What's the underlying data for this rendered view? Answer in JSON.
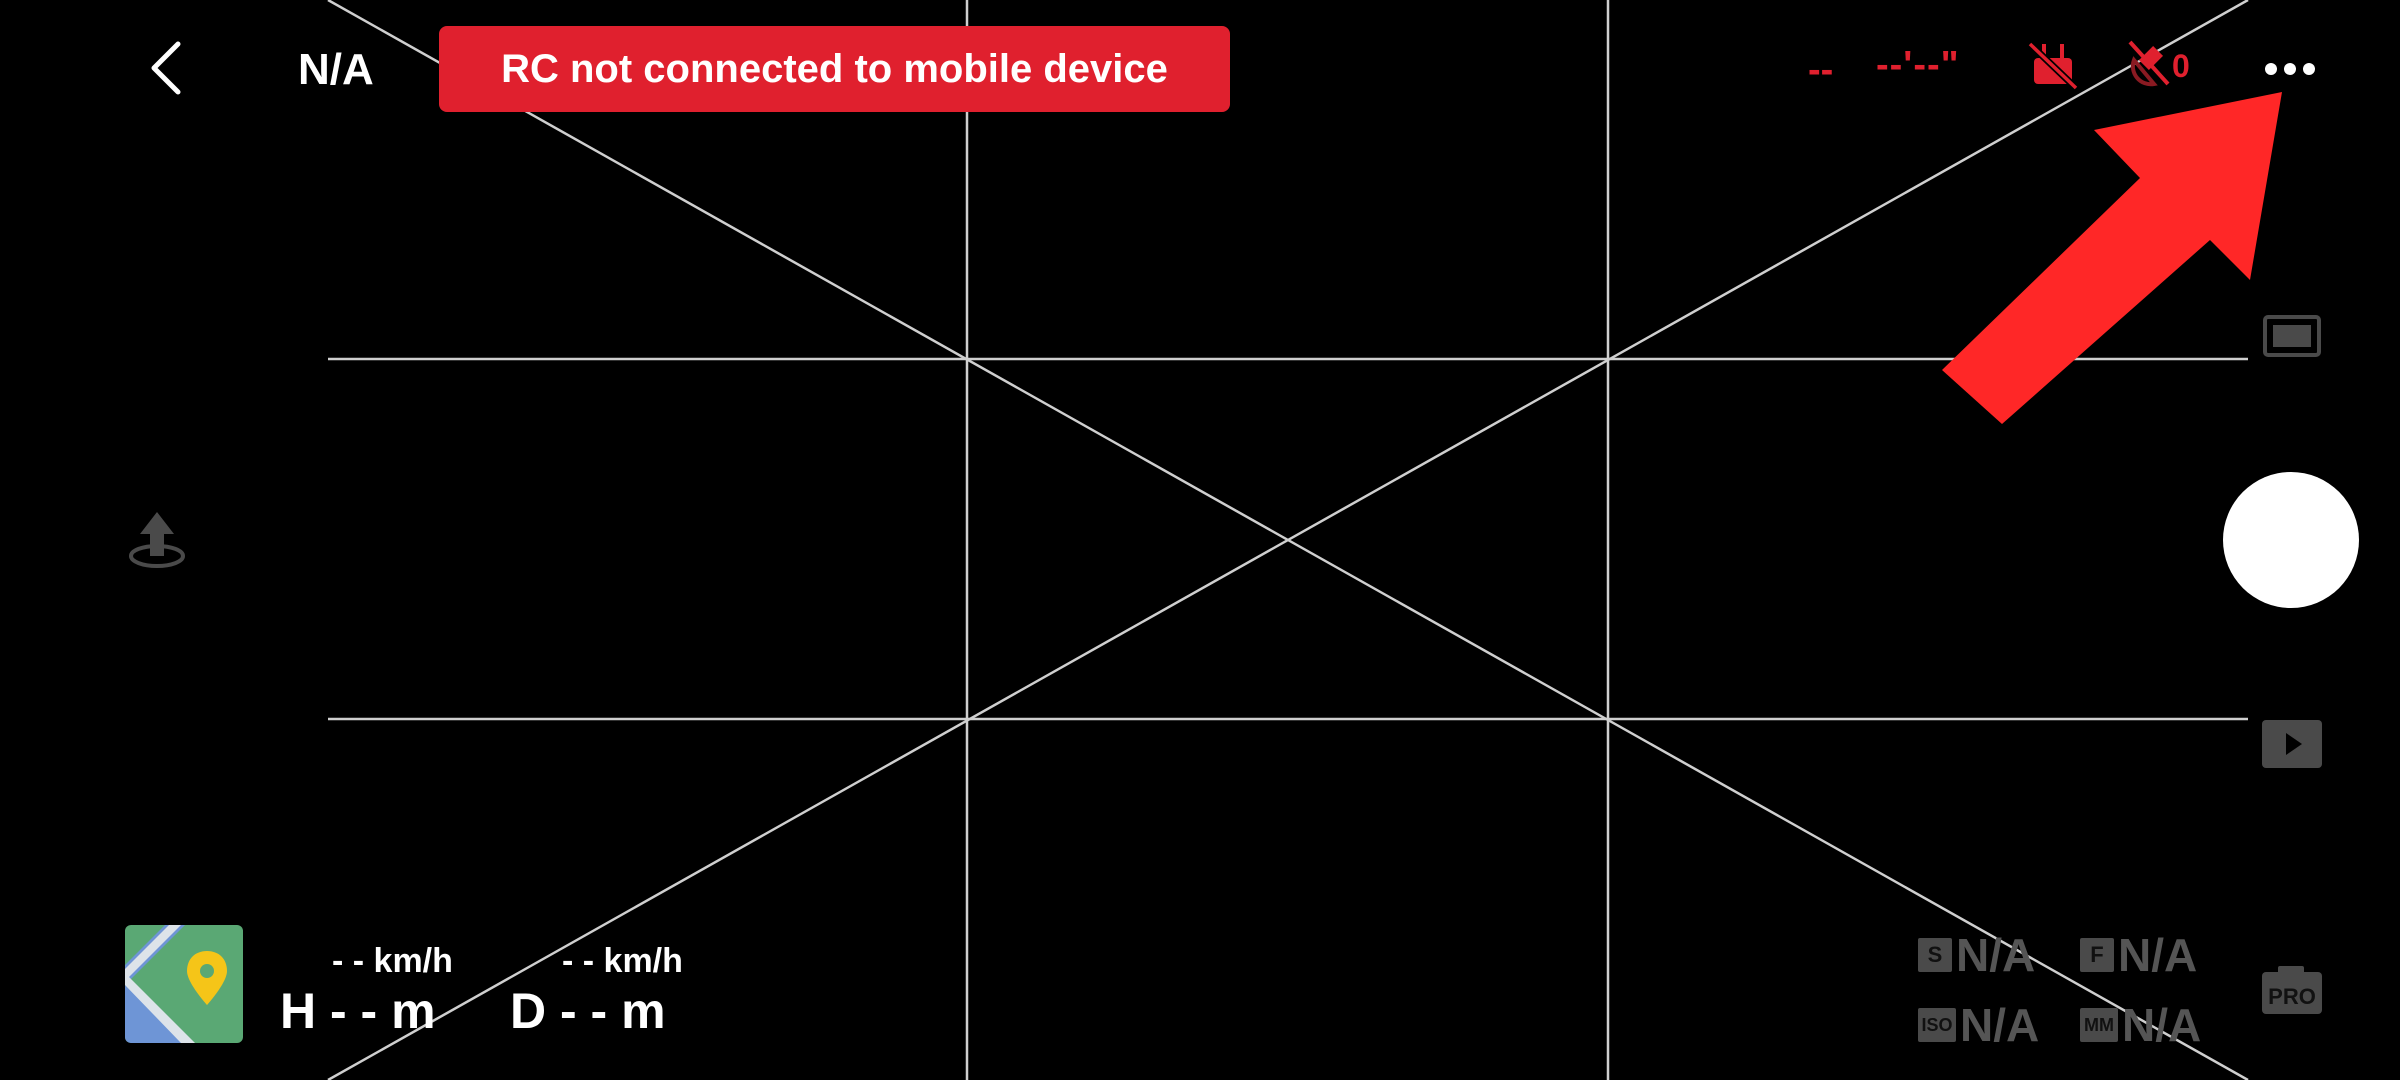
{
  "header": {
    "aircraft_name": "N/A",
    "status_banner": "RC not connected to mobile device",
    "battery": "--",
    "flight_time": "--'--\"",
    "gps_satellites": "0"
  },
  "telemetry": {
    "horizontal_speed": "- - km/h",
    "vertical_speed": "- - km/h",
    "height": "H - - m",
    "distance": "D - - m"
  },
  "camera_params": {
    "shutter_badge": "S",
    "shutter_value": "N/A",
    "aperture_badge": "F",
    "aperture_value": "N/A",
    "iso_badge": "ISO",
    "iso_value": "N/A",
    "ev_badge": "MM",
    "ev_value": "N/A"
  },
  "side_controls": {
    "pro_label": "PRO"
  },
  "icons": {
    "back": "chevron-left-icon",
    "rc_signal": "rc-signal-off-icon",
    "gps": "gps-satellite-off-icon",
    "more": "more-dots-icon",
    "takeoff": "takeoff-icon",
    "aspect": "aspect-ratio-icon",
    "playback": "playback-icon",
    "pro": "pro-camera-icon",
    "map": "map-icon"
  },
  "colors": {
    "alert_red": "#e0202e",
    "annotation_arrow": "#ff2727",
    "grid_line": "#cfcfcf",
    "inactive_gray": "#555555"
  }
}
